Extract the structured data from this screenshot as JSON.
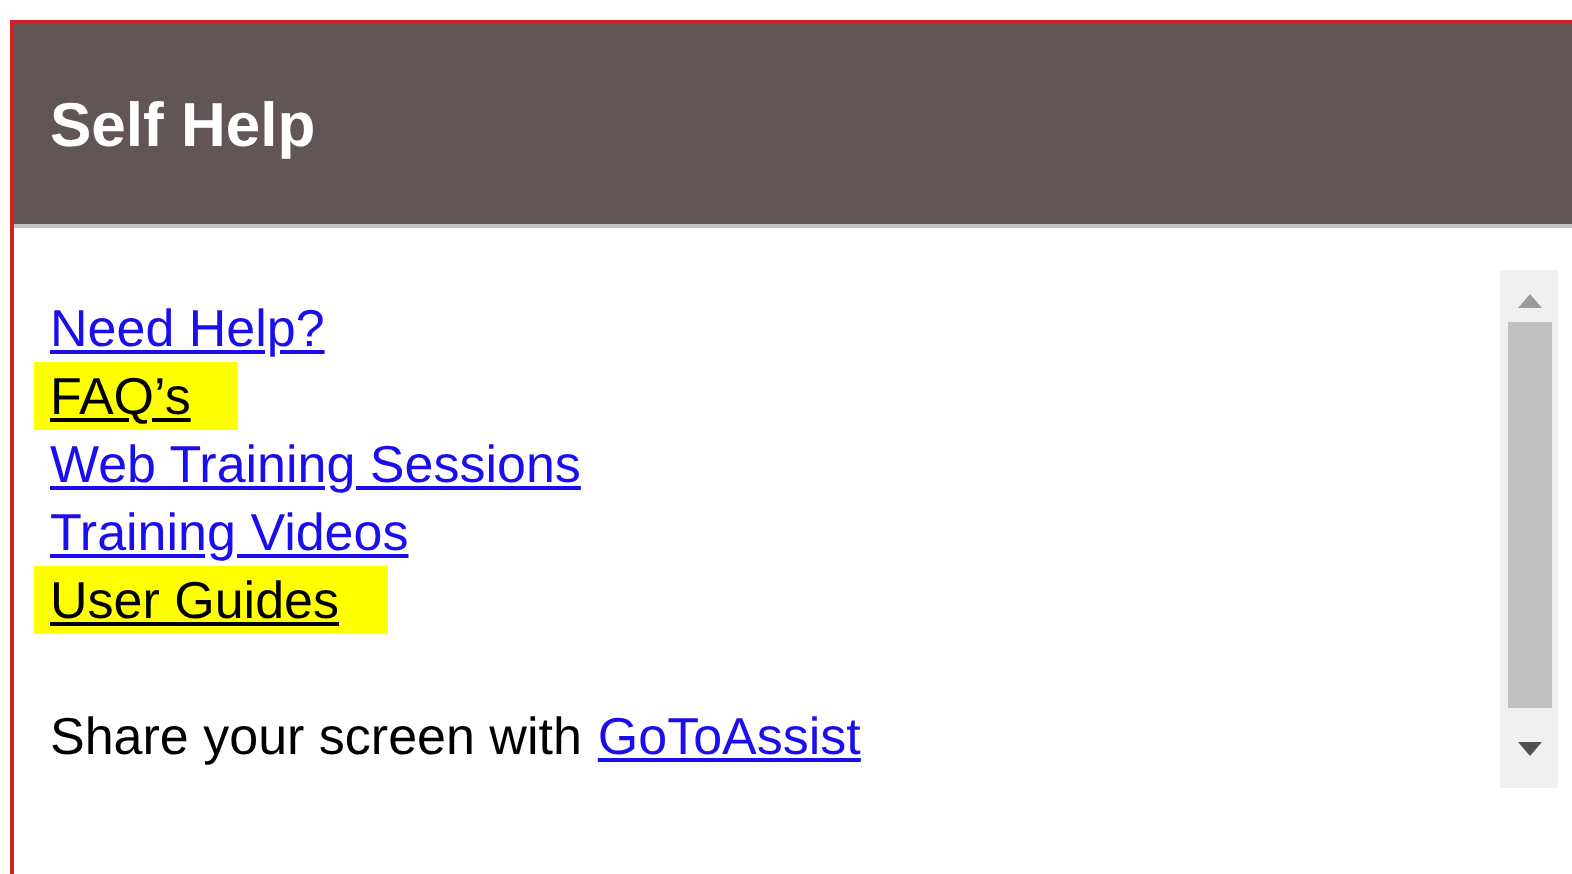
{
  "panel": {
    "title": "Self Help"
  },
  "links": [
    {
      "label": "Need Help?",
      "highlighted": false
    },
    {
      "label": "FAQ’s",
      "highlighted": true
    },
    {
      "label": "Web Training Sessions",
      "highlighted": false
    },
    {
      "label": "Training Videos",
      "highlighted": false
    },
    {
      "label": "User Guides",
      "highlighted": true
    }
  ],
  "share": {
    "text": "Share your screen with",
    "link": "GoToAssist"
  }
}
